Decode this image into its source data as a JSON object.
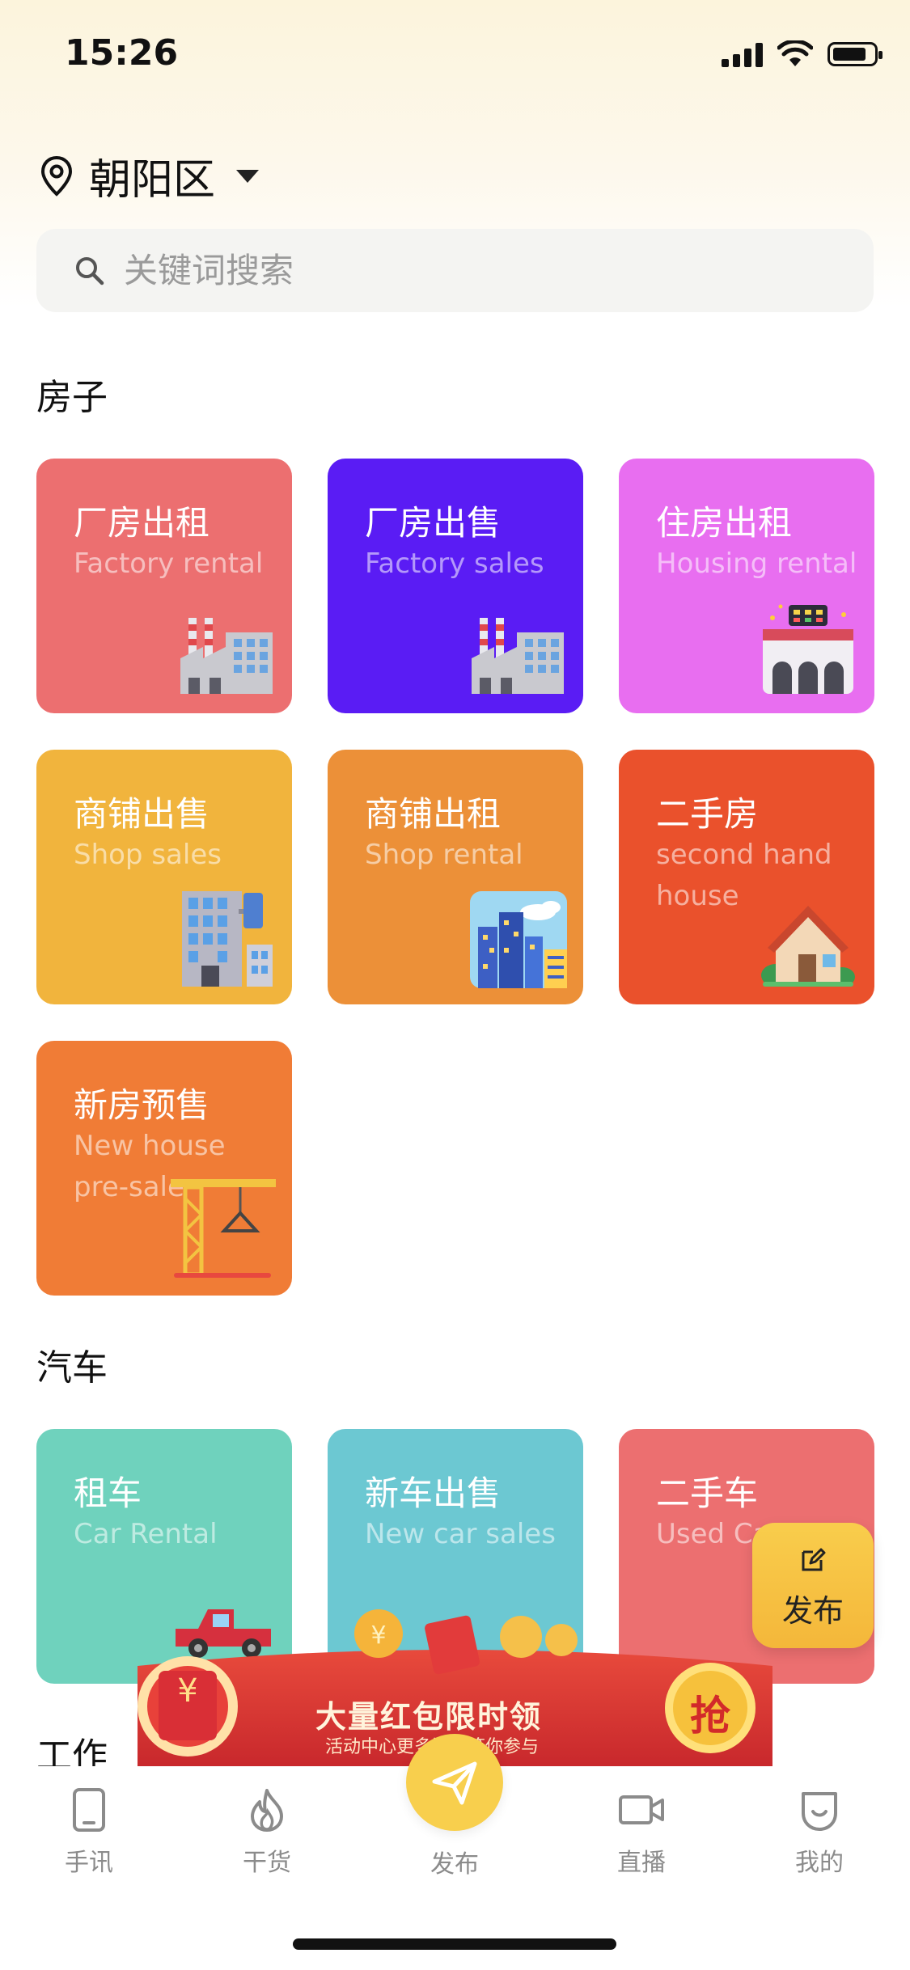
{
  "status_bar": {
    "time": "15:26"
  },
  "location": {
    "name": "朝阳区"
  },
  "search": {
    "placeholder": "关键词搜索"
  },
  "sections": {
    "house": {
      "title": "房子",
      "tiles": [
        {
          "zh": "厂房出租",
          "en": "Factory rental",
          "color": "#ec6f70",
          "icon": "factory-icon"
        },
        {
          "zh": "厂房出售",
          "en": "Factory sales",
          "color": "#5a1cf4",
          "icon": "factory-icon"
        },
        {
          "zh": "住房出租",
          "en": "Housing rental",
          "color": "#e86ef0",
          "icon": "stadium-icon"
        },
        {
          "zh": "商铺出售",
          "en": "Shop sales",
          "color": "#f1b43d",
          "icon": "office-building-icon"
        },
        {
          "zh": "商铺出租",
          "en": "Shop rental",
          "color": "#ec9038",
          "icon": "city-icon"
        },
        {
          "zh": "二手房",
          "en": "second hand house",
          "color": "#ea512c",
          "icon": "house-icon"
        },
        {
          "zh": "新房预售",
          "en": "New house pre-sale",
          "color": "#f07c36",
          "icon": "crane-icon"
        }
      ]
    },
    "car": {
      "title": "汽车",
      "tiles": [
        {
          "zh": "租车",
          "en": "Car Rental",
          "color": "#6fd2bd",
          "icon": "pickup-truck-icon"
        },
        {
          "zh": "新车出售",
          "en": "New car sales",
          "color": "#6cc8d2",
          "icon": "car-icon"
        },
        {
          "zh": "二手车",
          "en": "Used Cars",
          "color": "#ec6f70",
          "icon": "car-icon"
        }
      ]
    },
    "work": {
      "title": "工作"
    }
  },
  "promo": {
    "headline": "大量红包限时领",
    "subline": "活动中心更多活动等你参与",
    "badge": "抢"
  },
  "float_button": {
    "label": "发布"
  },
  "nav": [
    {
      "label": "手讯",
      "icon": "tablet-icon"
    },
    {
      "label": "干货",
      "icon": "flame-icon"
    },
    {
      "label": "发布",
      "icon": "paper-plane-icon"
    },
    {
      "label": "直播",
      "icon": "video-camera-icon"
    },
    {
      "label": "我的",
      "icon": "profile-icon"
    }
  ],
  "colors": {
    "accent": "#f8cf4d",
    "nav_text": "#8b8b8b"
  }
}
